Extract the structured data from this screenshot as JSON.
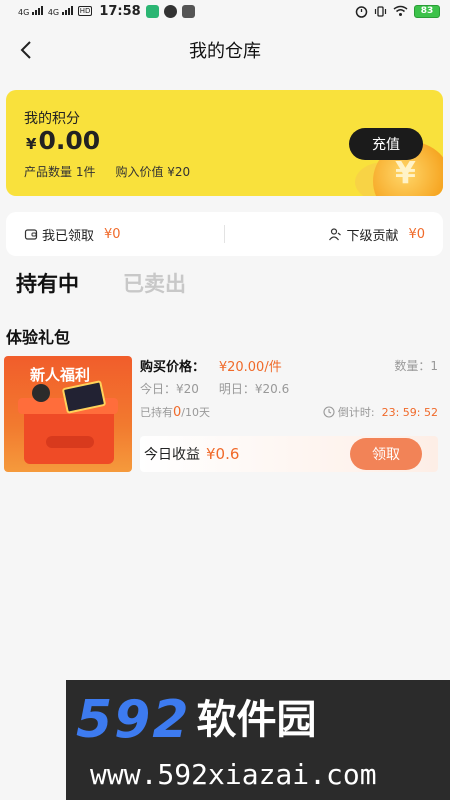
{
  "status_bar": {
    "signal_1": "4G",
    "signal_2": "4G",
    "hd": "HD",
    "time": "17:58",
    "battery": "83",
    "icons": [
      "wechat-icon",
      "chat-icon",
      "app-icon",
      "alarm-icon",
      "vibrate-icon",
      "wifi-icon",
      "battery-icon"
    ]
  },
  "nav": {
    "title": "我的仓库",
    "back_icon": "chevron-left-icon"
  },
  "points_card": {
    "label": "我的积分",
    "currency": "¥",
    "value": "0.00",
    "product_count": "产品数量 1件",
    "purchase_value": "购入价值 ¥20",
    "recharge_label": "充值",
    "card_color": "#f9e13c"
  },
  "claim_bar": {
    "my_claimed_label": "我已领取",
    "my_claimed_value": "¥0",
    "sub_contrib_label": "下级贡献",
    "sub_contrib_value": "¥0"
  },
  "tabs": [
    {
      "label": "持有中",
      "active": true
    },
    {
      "label": "已卖出",
      "active": false
    }
  ],
  "section": {
    "title": "体验礼包"
  },
  "gift": {
    "image_title": "新人福利",
    "buy_label": "购买价格：",
    "buy_price": "¥20.00/件",
    "qty": "数量：1",
    "today": "今日：¥20",
    "tomorrow": "明日：¥20.6",
    "held_prefix": "已持有",
    "held_num": "0",
    "held_suffix": "/10天",
    "countdown_label": "倒计时:",
    "countdown_value": "23: 59: 52",
    "earn_label": "今日收益",
    "earn_value": "¥0.6",
    "claim_label": "领取",
    "accent": "#f06a2a"
  },
  "watermark": {
    "num": "592",
    "cn": "软件园",
    "url": "www.592xiazai.com"
  }
}
